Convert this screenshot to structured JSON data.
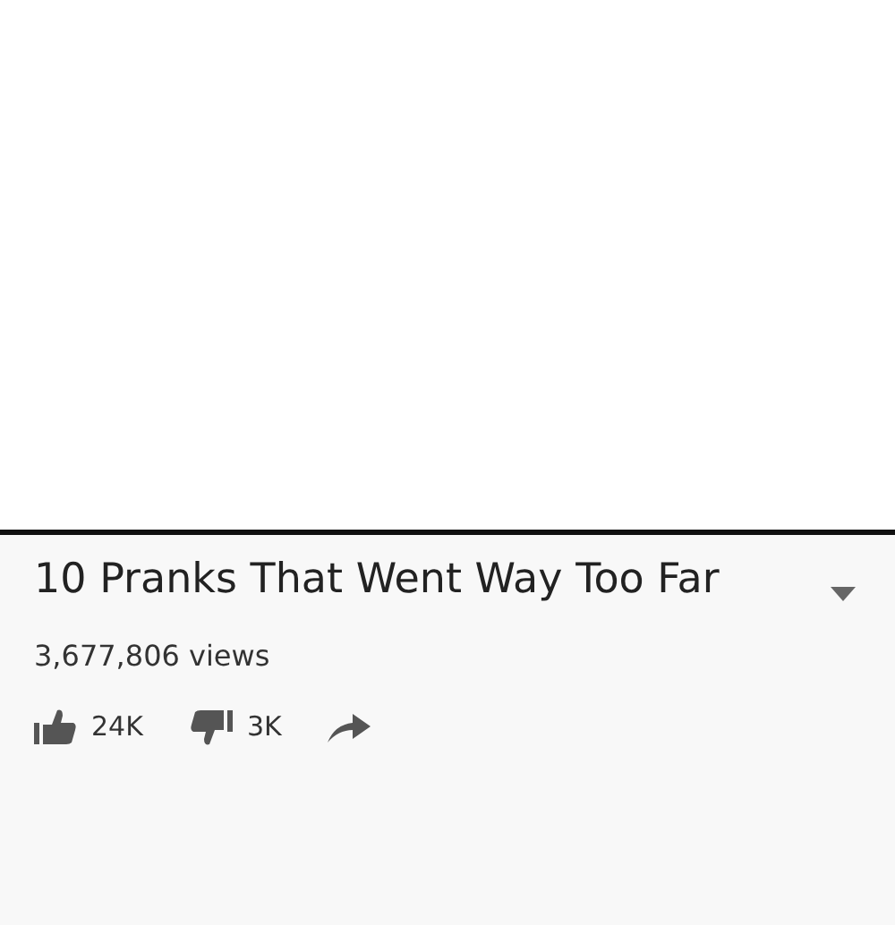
{
  "video": {
    "title": "10 Pranks That Went Way Too Far",
    "views": "3,677,806 views"
  },
  "actions": [
    {
      "kind": "like",
      "count": "24K"
    },
    {
      "kind": "dislike",
      "count": "3K"
    },
    {
      "kind": "share"
    }
  ]
}
